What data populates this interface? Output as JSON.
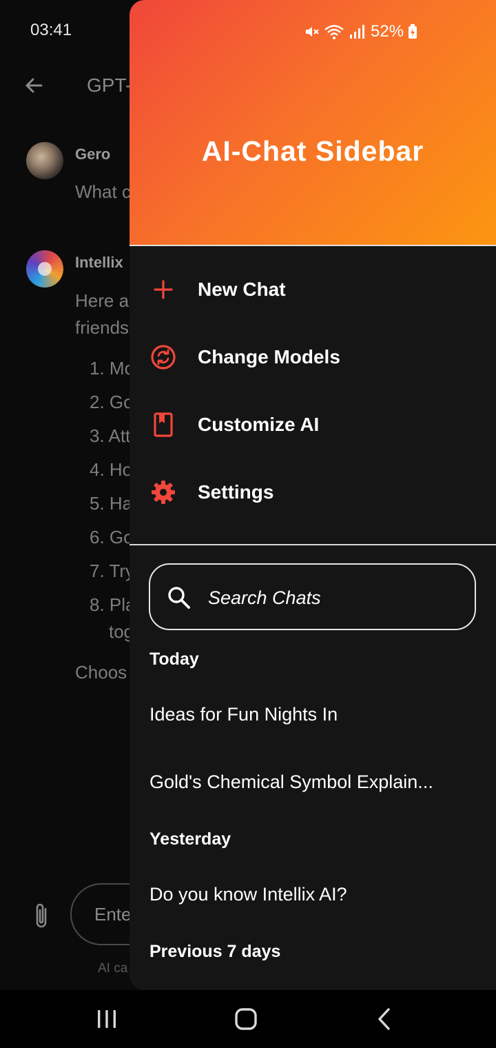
{
  "status_bar": {
    "time": "03:41",
    "battery": "52%"
  },
  "background_chat": {
    "title_fragment": "GPT-",
    "messages": [
      {
        "sender": "Gero",
        "text": "What c"
      },
      {
        "sender": "Intellix",
        "lines": [
          "Here a",
          "friends"
        ]
      }
    ],
    "list_fragments": [
      "1. Mo",
      "2. Go",
      "3. Att",
      "4. Ho",
      "5. Ha",
      "6. Go",
      "7. Try",
      "8. Pla",
      "tog"
    ],
    "closing_fragment": "Choos",
    "input_placeholder_fragment": "Ente",
    "footnote_fragment": "AI ca"
  },
  "drawer": {
    "title": "AI-Chat Sidebar",
    "accent_color": "#f0473a",
    "header_gradient": [
      "#f0473a",
      "#fc9610"
    ],
    "menu": [
      {
        "label": "New Chat",
        "icon": "plus-icon"
      },
      {
        "label": "Change Models",
        "icon": "sync-circle-icon"
      },
      {
        "label": "Customize AI",
        "icon": "bookmark-book-icon"
      },
      {
        "label": "Settings",
        "icon": "gear-icon"
      }
    ],
    "search": {
      "placeholder": "Search Chats",
      "icon": "search-icon"
    },
    "history": [
      {
        "heading": "Today",
        "chats": [
          "Ideas for Fun Nights In",
          "Gold's Chemical Symbol Explain..."
        ]
      },
      {
        "heading": "Yesterday",
        "chats": [
          "Do you know Intellix AI?"
        ]
      },
      {
        "heading": "Previous 7 days",
        "chats": []
      }
    ]
  },
  "nav_bar": {
    "buttons": [
      "recents-icon",
      "home-icon",
      "back-icon"
    ]
  }
}
